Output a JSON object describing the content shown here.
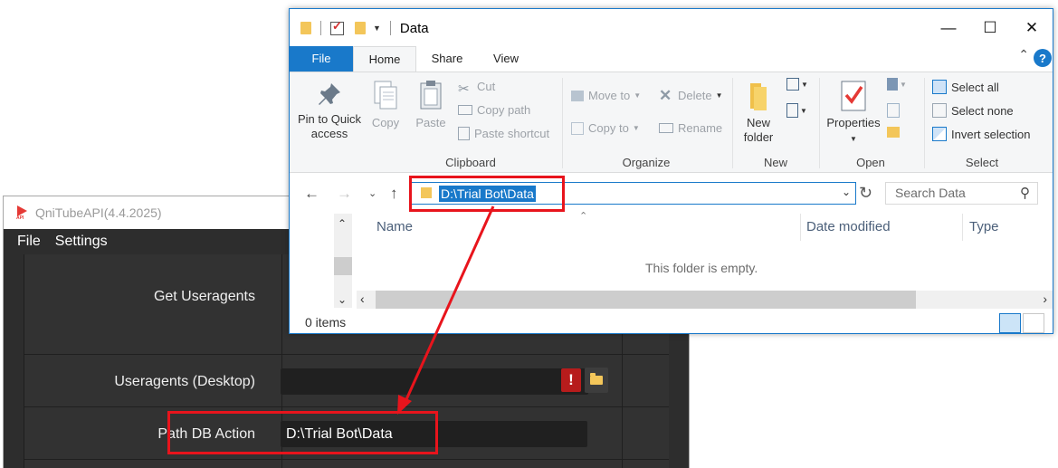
{
  "app": {
    "title": "QniTubeAPI(4.4.2025)",
    "menu": [
      "File",
      "Settings"
    ],
    "rows": {
      "useragents_label": "Get Useragents",
      "desktop_label": "Useragents (Desktop)",
      "path_label": "Path DB Action",
      "path_value": "D:\\Trial Bot\\Data",
      "warning_glyph": "!"
    }
  },
  "explorer": {
    "title": "Data",
    "tabs": {
      "file": "File",
      "home": "Home",
      "share": "Share",
      "view": "View"
    },
    "help": "?",
    "ribbon": {
      "clipboard": {
        "label": "Clipboard",
        "pin_line1": "Pin to Quick",
        "pin_line2": "access",
        "copy": "Copy",
        "paste": "Paste",
        "cut": "Cut",
        "copy_path": "Copy path",
        "paste_shortcut": "Paste shortcut"
      },
      "organize": {
        "label": "Organize",
        "move_to": "Move to",
        "copy_to": "Copy to",
        "delete": "Delete",
        "rename": "Rename"
      },
      "new": {
        "label": "New",
        "new_line1": "New",
        "new_line2": "folder"
      },
      "open": {
        "label": "Open",
        "properties": "Properties"
      },
      "select": {
        "label": "Select",
        "select_all": "Select all",
        "select_none": "Select none",
        "invert": "Invert selection"
      }
    },
    "address": "D:\\Trial Bot\\Data",
    "search_placeholder": "Search Data",
    "columns": [
      "Name",
      "Date modified",
      "Type"
    ],
    "empty_message": "This folder is empty.",
    "status": "0 items"
  },
  "colors": {
    "accent": "#1979ca",
    "annotation": "#e8141c",
    "app_bg": "#2d2d2d"
  }
}
